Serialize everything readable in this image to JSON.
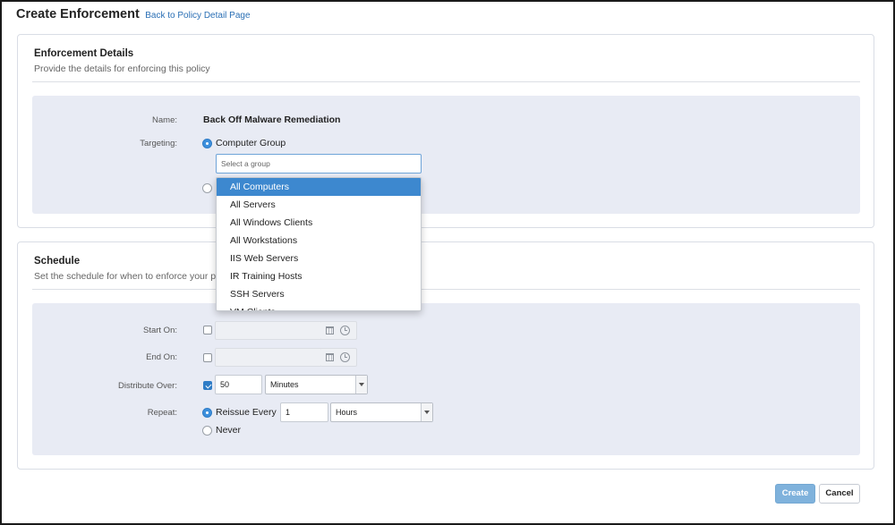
{
  "header": {
    "title": "Create Enforcement",
    "back_link": "Back to Policy Detail Page"
  },
  "details": {
    "title": "Enforcement Details",
    "subtitle": "Provide the details for enforcing this policy",
    "name_label": "Name:",
    "name_value": "Back Off Malware Remediation",
    "targeting_label": "Targeting:",
    "computer_group_option": "Computer Group",
    "group_search_placeholder": "Select a group",
    "group_options": [
      "All Computers",
      "All Servers",
      "All Windows Clients",
      "All Workstations",
      "IIS Web Servers",
      "IR Training Hosts",
      "SSH Servers",
      "VM Clients"
    ],
    "selected_group_index": 0
  },
  "schedule": {
    "title": "Schedule",
    "subtitle": "Set the schedule for when to enforce your policy",
    "start_label": "Start On:",
    "end_label": "End On:",
    "distribute_label": "Distribute Over:",
    "distribute_value": "50",
    "distribute_unit": "Minutes",
    "repeat_label": "Repeat:",
    "reissue_option": "Reissue Every",
    "reissue_value": "1",
    "reissue_unit": "Hours",
    "never_option": "Never"
  },
  "actions": {
    "create": "Create",
    "cancel": "Cancel"
  },
  "colors": {
    "accent": "#3d88cf",
    "link": "#2a6fb5",
    "panel_inner": "#e8ebf4",
    "create_button": "#7fb2dc"
  }
}
